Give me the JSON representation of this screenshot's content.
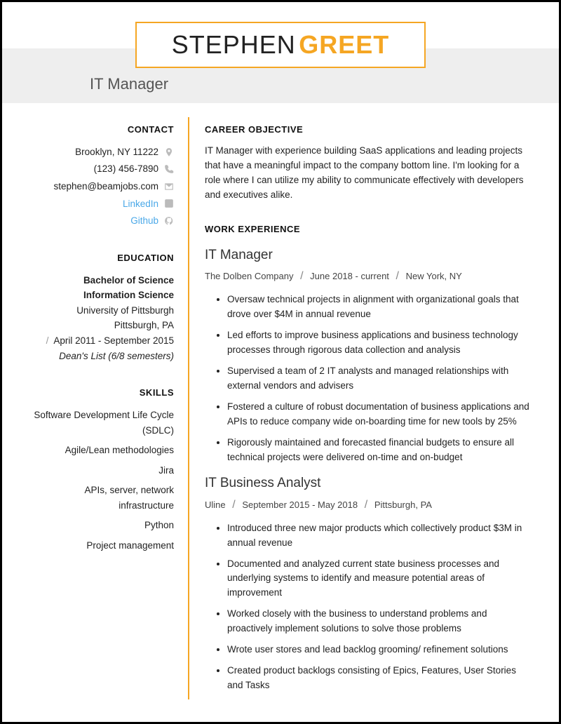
{
  "name": {
    "first": "STEPHEN",
    "last": "GREET"
  },
  "title": "IT Manager",
  "contact": {
    "heading": "CONTACT",
    "address": "Brooklyn, NY 11222",
    "phone": "(123) 456-7890",
    "email": "stephen@beamjobs.com",
    "linkedin": "LinkedIn",
    "github": "Github"
  },
  "education": {
    "heading": "EDUCATION",
    "degree": "Bachelor of Science",
    "major": "Information Science",
    "school": "University of Pittsburgh",
    "location": "Pittsburgh, PA",
    "dates": "April 2011 - September 2015",
    "honors": "Dean's List (6/8 semesters)"
  },
  "skills": {
    "heading": "SKILLS",
    "items": [
      "Software Development Life Cycle (SDLC)",
      "Agile/Lean methodologies",
      "Jira",
      "APIs, server, network infrastructure",
      "Python",
      "Project management"
    ]
  },
  "objective": {
    "heading": "CAREER OBJECTIVE",
    "text": "IT Manager with experience building SaaS applications and leading projects that have a meaningful impact to the company bottom line. I'm looking for a role where I can utilize my ability to communicate effectively with developers and executives alike."
  },
  "experience": {
    "heading": "WORK EXPERIENCE",
    "jobs": [
      {
        "title": "IT Manager",
        "company": "The Dolben Company",
        "dates": "June 2018 - current",
        "location": "New York, NY",
        "bullets": [
          "Oversaw technical projects in alignment with organizational goals that drove over $4M in annual revenue",
          "Led efforts to improve business applications and business technology processes through rigorous data collection and analysis",
          "Supervised a team of 2 IT analysts and managed relationships with external vendors and advisers",
          "Fostered a culture of robust documentation of business applications and APIs to reduce company wide on-boarding time for new tools by 25%",
          "Rigorously maintained and forecasted financial budgets to ensure all technical projects were delivered on-time and on-budget"
        ]
      },
      {
        "title": "IT Business Analyst",
        "company": "Uline",
        "dates": "September 2015 - May 2018",
        "location": "Pittsburgh, PA",
        "bullets": [
          "Introduced three new major products which collectively product $3M in annual revenue",
          "Documented and analyzed current state business processes and underlying systems to identify and measure potential areas of improvement",
          "Worked closely with the business to understand problems and proactively implement solutions to solve those problems",
          "Wrote user stores and lead backlog grooming/ refinement solutions",
          "Created product backlogs consisting of Epics, Features, User Stories and Tasks"
        ]
      }
    ]
  }
}
